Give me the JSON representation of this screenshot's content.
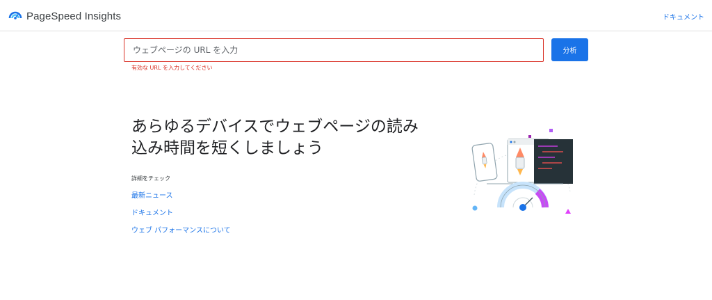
{
  "header": {
    "app_name": "PageSpeed Insights",
    "docs_link": "ドキュメント"
  },
  "form": {
    "url_placeholder": "ウェブページの URL を入力",
    "url_value": "",
    "analyze_button": "分析",
    "error_message": "有効な URL を入力してください"
  },
  "hero": {
    "headline_line1": "あらゆるデバイスでウェブページの読み",
    "headline_line2": "込み時間を短くしましょう"
  },
  "more": {
    "label": "詳細をチェック",
    "links": [
      "最新ニュース",
      "ドキュメント",
      "ウェブ パフォーマンスについて"
    ]
  },
  "colors": {
    "accent": "#1a73e8",
    "error": "#d93025",
    "gauge_purple": "#c74cf5",
    "gauge_light": "#c7e3fb"
  }
}
